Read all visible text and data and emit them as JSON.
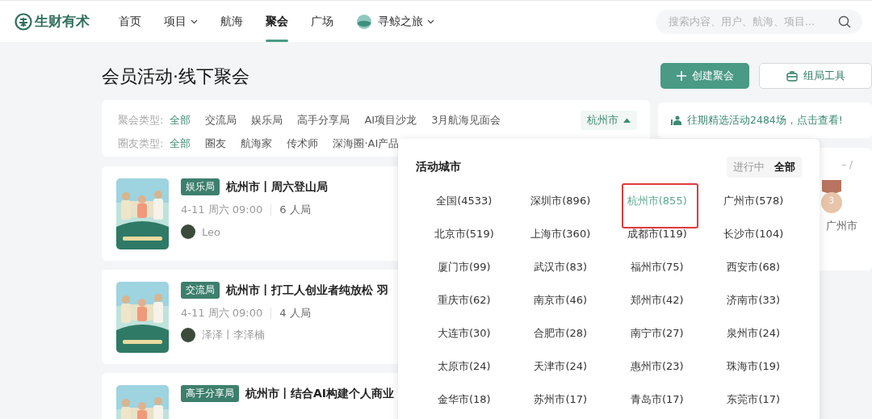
{
  "nav": {
    "logo": "生财有术",
    "items": [
      {
        "label": "首页",
        "selected": false,
        "kind": "plain"
      },
      {
        "label": "项目",
        "selected": false,
        "kind": "menu"
      },
      {
        "label": "航海",
        "selected": false,
        "kind": "plain"
      },
      {
        "label": "聚会",
        "selected": true,
        "kind": "plain"
      },
      {
        "label": "广场",
        "selected": false,
        "kind": "plain"
      },
      {
        "label": "寻鲸之旅",
        "selected": false,
        "kind": "globe_menu"
      }
    ],
    "search": {
      "placeholder": "搜索内容、用户、航海、项目..."
    }
  },
  "page_title": "会员活动·线下聚会",
  "actions": [
    {
      "label": "创建聚会",
      "kind": "primary"
    },
    {
      "label": "组局工具",
      "kind": "tool"
    }
  ],
  "filters": [
    {
      "label": "聚会类型:",
      "options": [
        {
          "label": "全部",
          "selected": true
        },
        {
          "label": "交流局",
          "selected": false
        },
        {
          "label": "娱乐局",
          "selected": false
        },
        {
          "label": "高手分享局",
          "selected": false
        },
        {
          "label": "AI项目沙龙",
          "selected": false
        },
        {
          "label": "3月航海见面会",
          "selected": false
        }
      ]
    },
    {
      "label": "圈友类型:",
      "options": [
        {
          "label": "全部",
          "selected": true
        },
        {
          "label": "圈友",
          "selected": false
        },
        {
          "label": "航海家",
          "selected": false
        },
        {
          "label": "传术师",
          "selected": false
        },
        {
          "label": "深海圈·AI产品",
          "selected": false
        }
      ]
    }
  ],
  "city_button": {
    "label": "杭州市",
    "expanded": true
  },
  "events": [
    {
      "tag": "娱乐局",
      "title": "杭州市丨周六登山局",
      "time": "4-11 周六 09:00",
      "size": "6 人局",
      "host": "Leo"
    },
    {
      "tag": "交流局",
      "title": "杭州市丨打工人创业者纯放松 羽",
      "time": "4-11 周六 09:00",
      "size": "4 人局",
      "host": "泽泽丨李泽楠"
    },
    {
      "tag": "高手分享局",
      "title": "杭州市丨结合AI构建个人商业"
    }
  ],
  "notice": "往期精选活动2484场，点击查看!",
  "ranking": {
    "header": "– /",
    "medal": "3",
    "city": "广州市"
  },
  "city_dropdown": {
    "title": "活动城市",
    "toggle": [
      {
        "label": "进行中",
        "selected": false
      },
      {
        "label": "全部",
        "selected": true
      }
    ],
    "cities": [
      {
        "label": "全国(4533)",
        "selected": false,
        "highlighted": false
      },
      {
        "label": "深圳市(896)",
        "selected": false,
        "highlighted": false
      },
      {
        "label": "杭州市(855)",
        "selected": true,
        "highlighted": true
      },
      {
        "label": "广州市(578)",
        "selected": false,
        "highlighted": false
      },
      {
        "label": "北京市(519)",
        "selected": false,
        "highlighted": false
      },
      {
        "label": "上海市(360)",
        "selected": false,
        "highlighted": false
      },
      {
        "label": "成都市(119)",
        "selected": false,
        "highlighted": false
      },
      {
        "label": "长沙市(104)",
        "selected": false,
        "highlighted": false
      },
      {
        "label": "厦门市(99)",
        "selected": false,
        "highlighted": false
      },
      {
        "label": "武汉市(83)",
        "selected": false,
        "highlighted": false
      },
      {
        "label": "福州市(75)",
        "selected": false,
        "highlighted": false
      },
      {
        "label": "西安市(68)",
        "selected": false,
        "highlighted": false
      },
      {
        "label": "重庆市(62)",
        "selected": false,
        "highlighted": false
      },
      {
        "label": "南京市(46)",
        "selected": false,
        "highlighted": false
      },
      {
        "label": "郑州市(42)",
        "selected": false,
        "highlighted": false
      },
      {
        "label": "济南市(33)",
        "selected": false,
        "highlighted": false
      },
      {
        "label": "大连市(30)",
        "selected": false,
        "highlighted": false
      },
      {
        "label": "合肥市(28)",
        "selected": false,
        "highlighted": false
      },
      {
        "label": "南宁市(27)",
        "selected": false,
        "highlighted": false
      },
      {
        "label": "泉州市(24)",
        "selected": false,
        "highlighted": false
      },
      {
        "label": "太原市(24)",
        "selected": false,
        "highlighted": false
      },
      {
        "label": "天津市(24)",
        "selected": false,
        "highlighted": false
      },
      {
        "label": "惠州市(23)",
        "selected": false,
        "highlighted": false
      },
      {
        "label": "珠海市(19)",
        "selected": false,
        "highlighted": false
      },
      {
        "label": "金华市(18)",
        "selected": false,
        "highlighted": false
      },
      {
        "label": "苏州市(17)",
        "selected": false,
        "highlighted": false
      },
      {
        "label": "青岛市(17)",
        "selected": false,
        "highlighted": false
      },
      {
        "label": "东莞市(17)",
        "selected": false,
        "highlighted": false
      }
    ]
  }
}
